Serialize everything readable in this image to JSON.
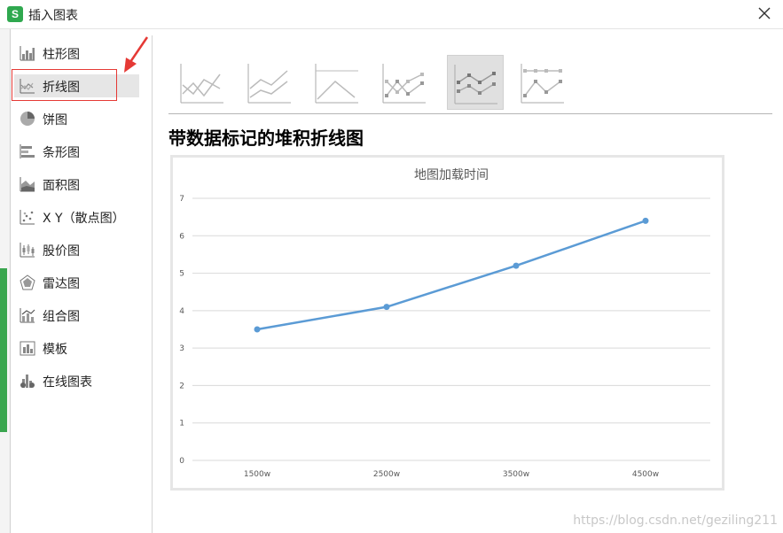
{
  "window": {
    "title": "插入图表",
    "app_icon_letter": "S"
  },
  "sidebar": {
    "items": [
      {
        "label": "柱形图",
        "icon": "bar-chart-icon"
      },
      {
        "label": "折线图",
        "icon": "line-chart-icon",
        "active": true
      },
      {
        "label": "饼图",
        "icon": "pie-chart-icon"
      },
      {
        "label": "条形图",
        "icon": "horizontal-bar-chart-icon"
      },
      {
        "label": "面积图",
        "icon": "area-chart-icon"
      },
      {
        "label": "X Y（散点图）",
        "icon": "scatter-chart-icon"
      },
      {
        "label": "股价图",
        "icon": "stock-chart-icon"
      },
      {
        "label": "雷达图",
        "icon": "radar-chart-icon"
      },
      {
        "label": "组合图",
        "icon": "combo-chart-icon"
      },
      {
        "label": "模板",
        "icon": "template-icon"
      },
      {
        "label": "在线图表",
        "icon": "online-chart-icon"
      }
    ]
  },
  "subtypes": {
    "selected_index": 4,
    "items": [
      "line-subtype-1",
      "line-subtype-2",
      "line-subtype-3",
      "line-subtype-4",
      "line-subtype-5",
      "line-subtype-6"
    ]
  },
  "preview": {
    "title": "带数据标记的堆积折线图"
  },
  "chart_data": {
    "type": "line",
    "title": "地图加载时间",
    "categories": [
      "1500w",
      "2500w",
      "3500w",
      "4500w"
    ],
    "series": [
      {
        "values": [
          3.5,
          4.1,
          5.2,
          6.4
        ],
        "color": "#5b9bd5"
      }
    ],
    "ylim": [
      0,
      7
    ],
    "yticks": [
      "0",
      "1",
      "2",
      "3",
      "4",
      "5",
      "6",
      "7"
    ],
    "grid": true,
    "markers": true
  },
  "watermark": "https://blog.csdn.net/geziling211"
}
